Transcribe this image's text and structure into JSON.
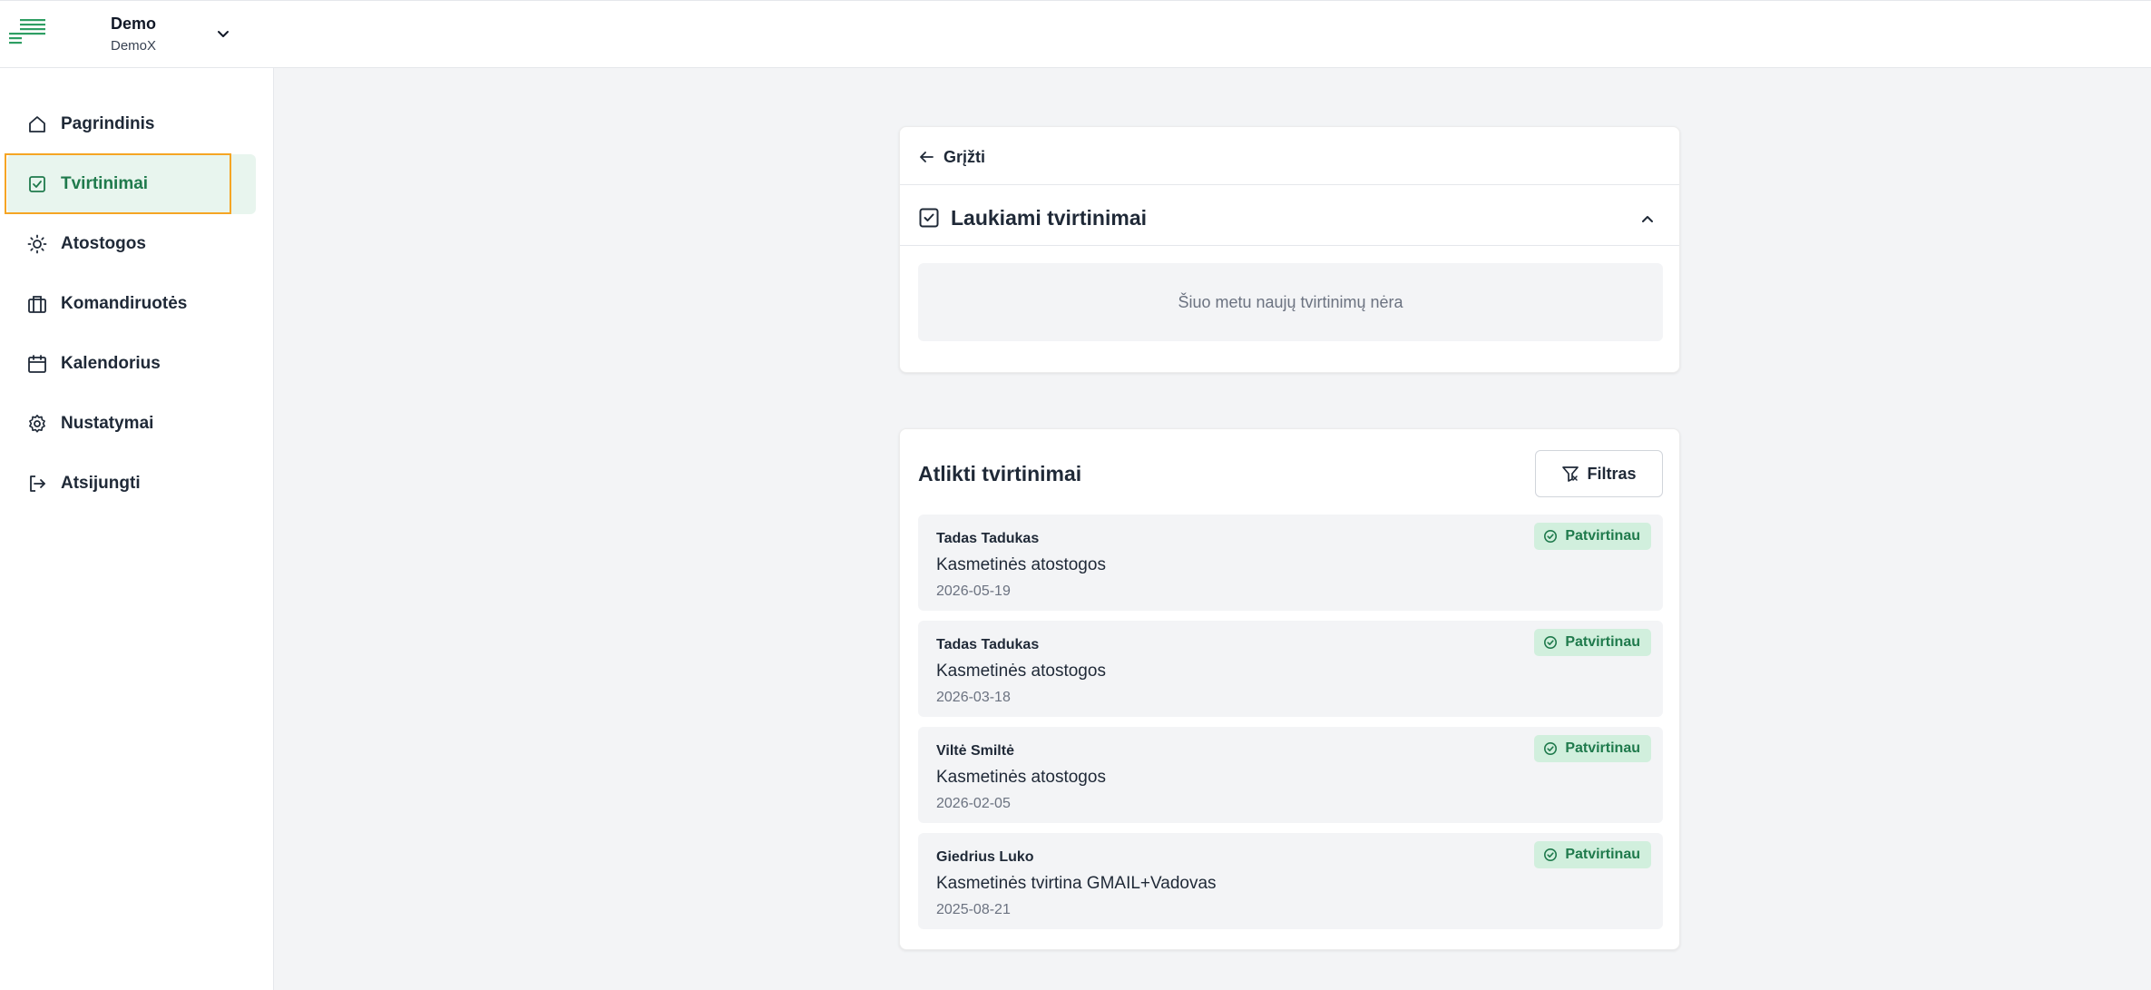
{
  "org": {
    "name": "Demo",
    "sub": "DemoX"
  },
  "sidebar": {
    "items": [
      {
        "label": "Pagrindinis",
        "icon": "home-icon"
      },
      {
        "label": "Tvirtinimai",
        "icon": "check-square-icon",
        "active": true
      },
      {
        "label": "Atostogos",
        "icon": "sun-icon"
      },
      {
        "label": "Komandiruotės",
        "icon": "briefcase-icon"
      },
      {
        "label": "Kalendorius",
        "icon": "calendar-icon"
      },
      {
        "label": "Nustatymai",
        "icon": "gear-icon"
      },
      {
        "label": "Atsijungti",
        "icon": "logout-icon"
      }
    ]
  },
  "pending": {
    "back_label": "Grįžti",
    "title": "Laukiami tvirtinimai",
    "empty_text": "Šiuo metu naujų tvirtinimų nėra"
  },
  "done": {
    "title": "Atlikti tvirtinimai",
    "filter_label": "Filtras",
    "items": [
      {
        "name": "Tadas Tadukas",
        "type": "Kasmetinės atostogos",
        "date": "2026-05-19",
        "status": "Patvirtinau"
      },
      {
        "name": "Tadas Tadukas",
        "type": "Kasmetinės atostogos",
        "date": "2026-03-18",
        "status": "Patvirtinau"
      },
      {
        "name": "Viltė Smiltė",
        "type": "Kasmetinės atostogos",
        "date": "2026-02-05",
        "status": "Patvirtinau"
      },
      {
        "name": "Giedrius Luko",
        "type": "Kasmetinės tvirtina GMAIL+Vadovas",
        "date": "2025-08-21",
        "status": "Patvirtinau"
      }
    ]
  },
  "colors": {
    "accent": "#1f7a4c",
    "active_bg": "#e8f5ee",
    "badge_bg": "#d1efdd",
    "highlight": "#f5a524"
  }
}
